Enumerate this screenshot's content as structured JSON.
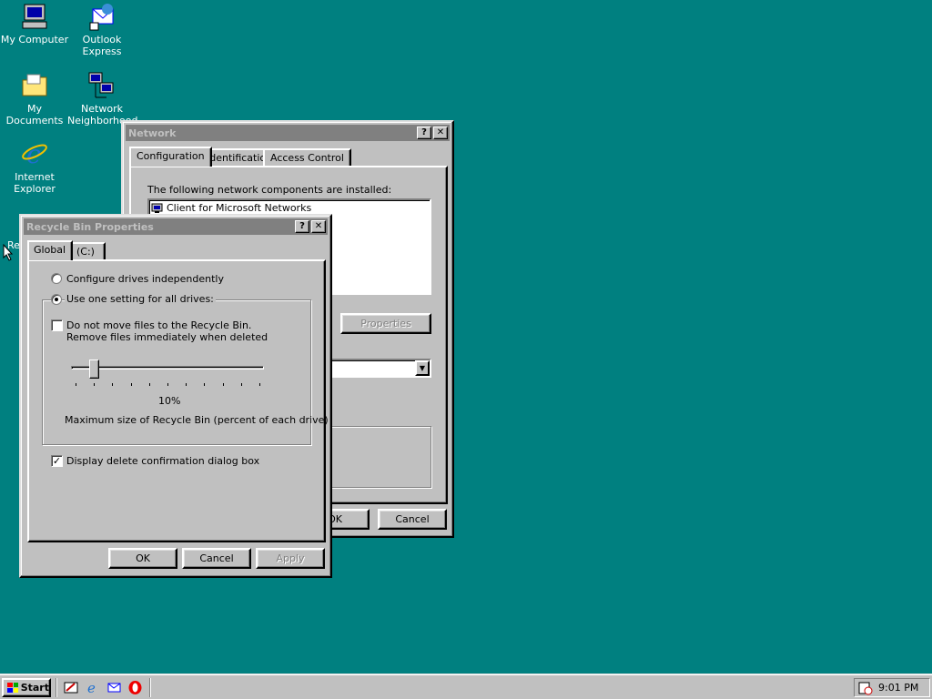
{
  "desktop": {
    "icons": [
      {
        "label": "My Computer"
      },
      {
        "label": "Outlook Express"
      },
      {
        "label": "My Documents"
      },
      {
        "label": "Network Neighborhood"
      },
      {
        "label": "Internet Explorer"
      },
      {
        "label": "Re"
      }
    ]
  },
  "network_dialog": {
    "title": "Network",
    "tabs": [
      "Configuration",
      "Identification",
      "Access Control"
    ],
    "installed_label": "The following network components are installed:",
    "components": [
      "Client for Microsoft Networks"
    ],
    "properties_button": "Properties",
    "ok_button": "OK",
    "cancel_button": "Cancel"
  },
  "recycle_dialog": {
    "title": "Recycle Bin Properties",
    "tabs": [
      "Global",
      "(C:)"
    ],
    "radio_independent": "Configure drives independently",
    "radio_one_setting": "Use one setting for all drives:",
    "do_not_move_line1": "Do not move files to the Recycle Bin.",
    "do_not_move_line2": "Remove files immediately when deleted",
    "slider_value_label": "10%",
    "slider_value": 0.1,
    "slider_caption": "Maximum size of Recycle Bin (percent of each drive)",
    "display_confirm": "Display delete confirmation dialog box",
    "ok_button": "OK",
    "cancel_button": "Cancel",
    "apply_button": "Apply"
  },
  "taskbar": {
    "start_label": "Start",
    "clock": "9:01 PM"
  },
  "colors": {
    "desktop": "#008080",
    "face": "#c0c0c0",
    "inactive_title": "#808080"
  }
}
